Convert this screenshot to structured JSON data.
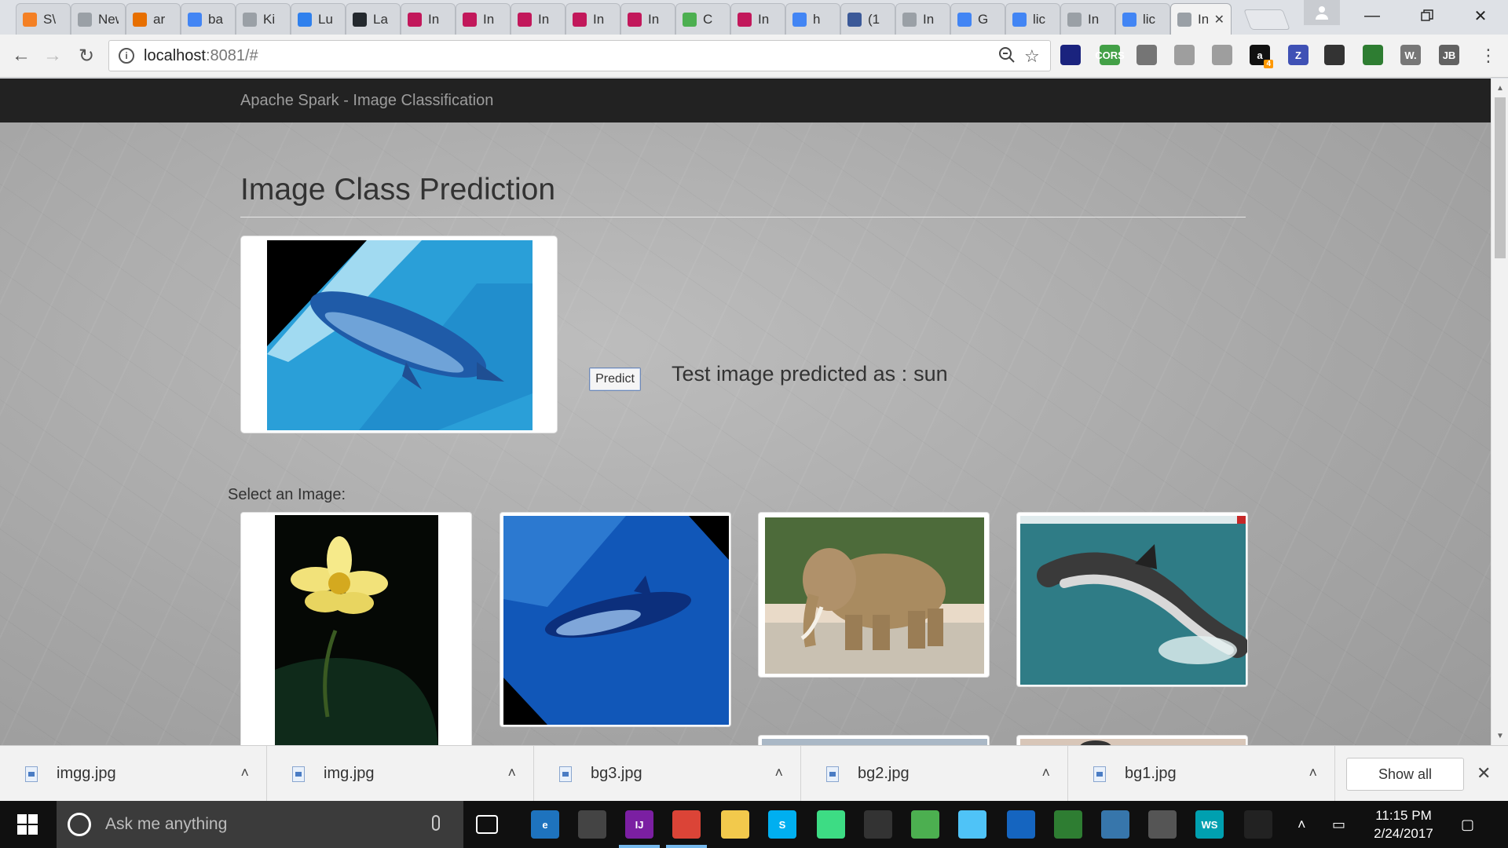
{
  "browser": {
    "tabs": [
      {
        "title": "S\\",
        "icon": "stack-icon",
        "color": "#f48024"
      },
      {
        "title": "New T",
        "icon": "blank-icon",
        "color": "#9aa0a6"
      },
      {
        "title": "ar",
        "icon": "java-icon",
        "color": "#e76f00"
      },
      {
        "title": "ba",
        "icon": "google-icon",
        "color": "#4285f4"
      },
      {
        "title": "Ki",
        "icon": "page-icon",
        "color": "#9aa0a6"
      },
      {
        "title": "Lu",
        "icon": "lucene-icon",
        "color": "#2f80ed"
      },
      {
        "title": "La",
        "icon": "github-icon",
        "color": "#24292e"
      },
      {
        "title": "In",
        "icon": "intellij-icon",
        "color": "#c2185b"
      },
      {
        "title": "In",
        "icon": "intellij-icon",
        "color": "#c2185b"
      },
      {
        "title": "In",
        "icon": "intellij-icon",
        "color": "#c2185b"
      },
      {
        "title": "In",
        "icon": "intellij-icon",
        "color": "#c2185b"
      },
      {
        "title": "In",
        "icon": "intellij-icon",
        "color": "#c2185b"
      },
      {
        "title": "C",
        "icon": "w3-icon",
        "color": "#4caf50"
      },
      {
        "title": "In",
        "icon": "intellij-icon",
        "color": "#c2185b"
      },
      {
        "title": "h",
        "icon": "google-icon",
        "color": "#4285f4"
      },
      {
        "title": "(1",
        "icon": "facebook-icon",
        "color": "#3b5998"
      },
      {
        "title": "In",
        "icon": "page-icon",
        "color": "#9aa0a6"
      },
      {
        "title": "G",
        "icon": "google-icon",
        "color": "#4285f4"
      },
      {
        "title": "lic",
        "icon": "google-icon",
        "color": "#4285f4"
      },
      {
        "title": "In",
        "icon": "page-icon",
        "color": "#9aa0a6"
      },
      {
        "title": "lic",
        "icon": "google-icon",
        "color": "#4285f4"
      },
      {
        "title": "In",
        "icon": "blank-icon",
        "color": "#9aa0a6",
        "active": true
      }
    ],
    "url_host": "localhost",
    "url_rest": ":8081/#",
    "extensions": [
      {
        "name": "mystery-extension-icon",
        "label": "",
        "color": "#1a237e"
      },
      {
        "name": "cors-extension-icon",
        "label": "CORS",
        "color": "#43a047"
      },
      {
        "name": "cast-icon",
        "label": "",
        "color": "#757575"
      },
      {
        "name": "ghost-extension-icon",
        "label": "",
        "color": "#9e9e9e"
      },
      {
        "name": "shield-extension-icon",
        "label": "",
        "color": "#9e9e9e"
      },
      {
        "name": "amazon-extension-icon",
        "label": "a",
        "color": "#111111"
      },
      {
        "name": "zotero-extension-icon",
        "label": "Z",
        "color": "#3f51b5"
      },
      {
        "name": "eye-extension-icon",
        "label": "",
        "color": "#333333"
      },
      {
        "name": "translate-extension-icon",
        "label": "",
        "color": "#2e7d32"
      },
      {
        "name": "w-extension-icon",
        "label": "W.",
        "color": "#777777"
      },
      {
        "name": "jb-extension-icon",
        "label": "JB",
        "color": "#616161"
      }
    ],
    "amazon_badge": "4"
  },
  "app": {
    "brand": "Apache Spark - Image Classification",
    "page_title": "Image Class Prediction",
    "predict_label": "Predict",
    "result_label": "Test image predicted as :",
    "result_value": "sun",
    "select_label": "Select an Image:"
  },
  "downloads": {
    "files": [
      "imgg.jpg",
      "img.jpg",
      "bg3.jpg",
      "bg2.jpg",
      "bg1.jpg"
    ],
    "show_all": "Show all"
  },
  "taskbar": {
    "search_placeholder": "Ask me anything",
    "time": "11:15 PM",
    "date": "2/24/2017"
  }
}
